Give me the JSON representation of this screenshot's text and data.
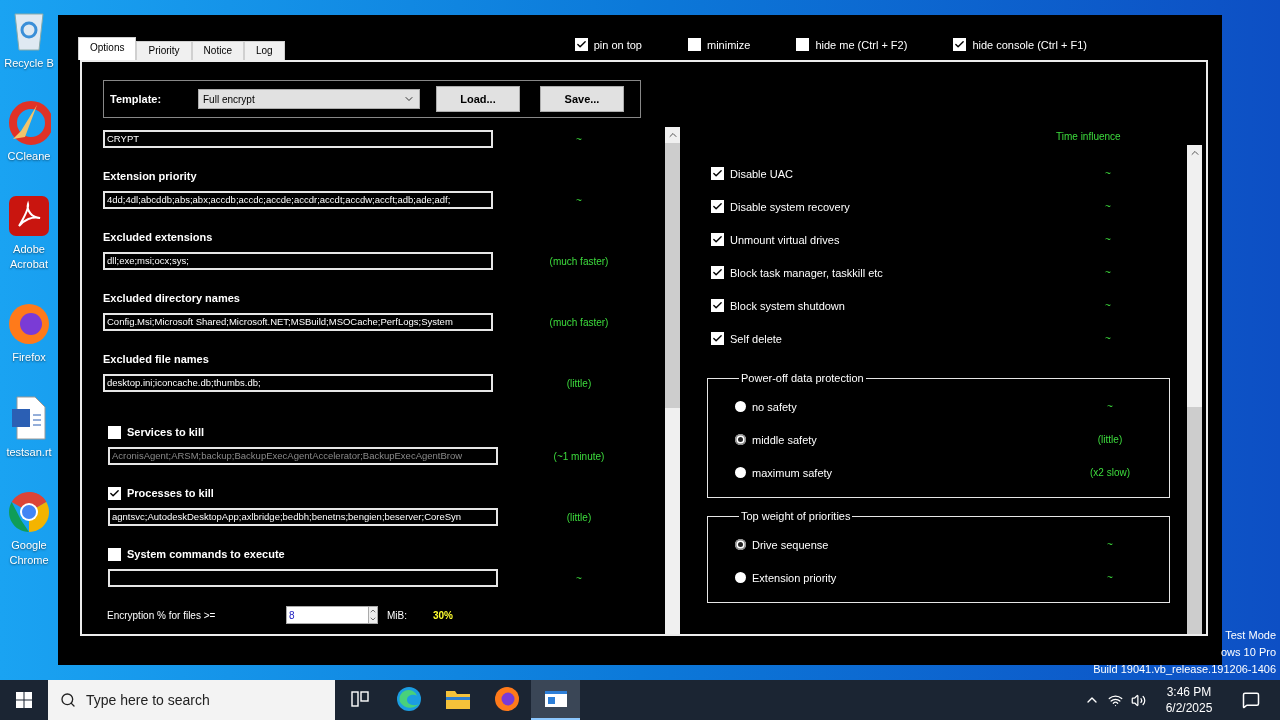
{
  "desktop_icons": [
    {
      "kind": "bin",
      "label": "Recycle B"
    },
    {
      "kind": "cleaner",
      "label": "CCleane"
    },
    {
      "kind": "pdf",
      "label": "Adobe Acrobat"
    },
    {
      "kind": "firefox",
      "label": "Firefox"
    },
    {
      "kind": "doc",
      "label": "testsan.rt"
    },
    {
      "kind": "chrome",
      "label": "Google Chrome"
    }
  ],
  "window": {
    "top_options": [
      {
        "label": "pin on top",
        "checked": true
      },
      {
        "label": "minimize",
        "checked": false
      },
      {
        "label": "hide me (Ctrl + F2)",
        "checked": false
      },
      {
        "label": "hide console (Ctrl + F1)",
        "checked": true
      }
    ],
    "tabs": [
      {
        "label": "Options",
        "selected": true
      },
      {
        "label": "Priority",
        "selected": false
      },
      {
        "label": "Notice",
        "selected": false
      },
      {
        "label": "Log",
        "selected": false
      }
    ],
    "template": {
      "label": "Template:",
      "value": "Full encrypt",
      "buttons": [
        "Load...",
        "Save..."
      ]
    },
    "fields": [
      {
        "kind": "text",
        "value": "CRYPT",
        "hint": "~"
      },
      {
        "kind": "labeled",
        "label": "Extension priority",
        "value": "4dd;4dl;abcddb;abs;abx;accdb;accdc;accde;accdr;accdt;accdw;accft;adb;ade;adf;",
        "hint": "~"
      },
      {
        "kind": "labeled",
        "label": "Excluded extensions",
        "value": "dll;exe;msi;ocx;sys;",
        "hint": "(much faster)"
      },
      {
        "kind": "labeled",
        "label": "Excluded directory names",
        "value": "Config.Msi;Microsoft Shared;Microsoft.NET;MSBuild;MSOCache;PerfLogs;System",
        "hint": "(much faster)"
      },
      {
        "kind": "labeled",
        "label": "Excluded file names",
        "value": "desktop.ini;iconcache.db;thumbs.db;",
        "hint": "(little)"
      },
      {
        "kind": "check",
        "label": "Services to kill",
        "checked": false,
        "value": "AcronisAgent;ARSM;backup;BackupExecAgentAccelerator;BackupExecAgentBrow",
        "hint": "(~1 minute)"
      },
      {
        "kind": "check",
        "label": "Processes to kill",
        "checked": true,
        "value": "agntsvc;AutodeskDesktopApp;axlbridge;bedbh;benetns;bengien;beserver;CoreSyn",
        "hint": "(little)"
      },
      {
        "kind": "check",
        "label": "System commands to execute",
        "checked": false,
        "hint": "~"
      }
    ],
    "encryption": {
      "label": "Encryption % for files >=",
      "value": "8",
      "unit": "MiB:",
      "percent": "30%"
    },
    "time_influence_label": "Time influence",
    "switches": [
      {
        "label": "Disable UAC",
        "checked": true,
        "hint": "~"
      },
      {
        "label": "Disable system recovery",
        "checked": true,
        "hint": "~"
      },
      {
        "label": "Unmount virtual drives",
        "checked": true,
        "hint": "~"
      },
      {
        "label": "Block task manager, taskkill etc",
        "checked": true,
        "hint": "~"
      },
      {
        "label": "Block system shutdown",
        "checked": true,
        "hint": "~"
      },
      {
        "label": "Self delete",
        "checked": true,
        "hint": "~"
      }
    ],
    "groups": [
      {
        "title": "Power-off data protection",
        "options": [
          {
            "label": "no safety",
            "selected": false,
            "hint": "~"
          },
          {
            "label": "middle safety",
            "selected": true,
            "hint": "(little)"
          },
          {
            "label": "maximum safety",
            "selected": false,
            "hint": "(x2 slow)"
          }
        ]
      },
      {
        "title": "Top weight of priorities",
        "options": [
          {
            "label": "Drive sequense",
            "selected": true,
            "hint": "~"
          },
          {
            "label": "Extension priority",
            "selected": false,
            "hint": "~"
          }
        ]
      }
    ]
  },
  "desktop_info": [
    "Test Mode",
    "ows 10 Pro",
    "Build 19041.vb_release.191206-1406"
  ],
  "taskbar": {
    "search_placeholder": "Type here to search",
    "apps": [
      {
        "kind": "task-view",
        "selected": false
      },
      {
        "kind": "edge",
        "selected": false
      },
      {
        "kind": "folder",
        "selected": false
      },
      {
        "kind": "firefox",
        "selected": false
      },
      {
        "kind": "app",
        "selected": true
      }
    ],
    "time": "3:46 PM",
    "date": "6/2/2025"
  }
}
